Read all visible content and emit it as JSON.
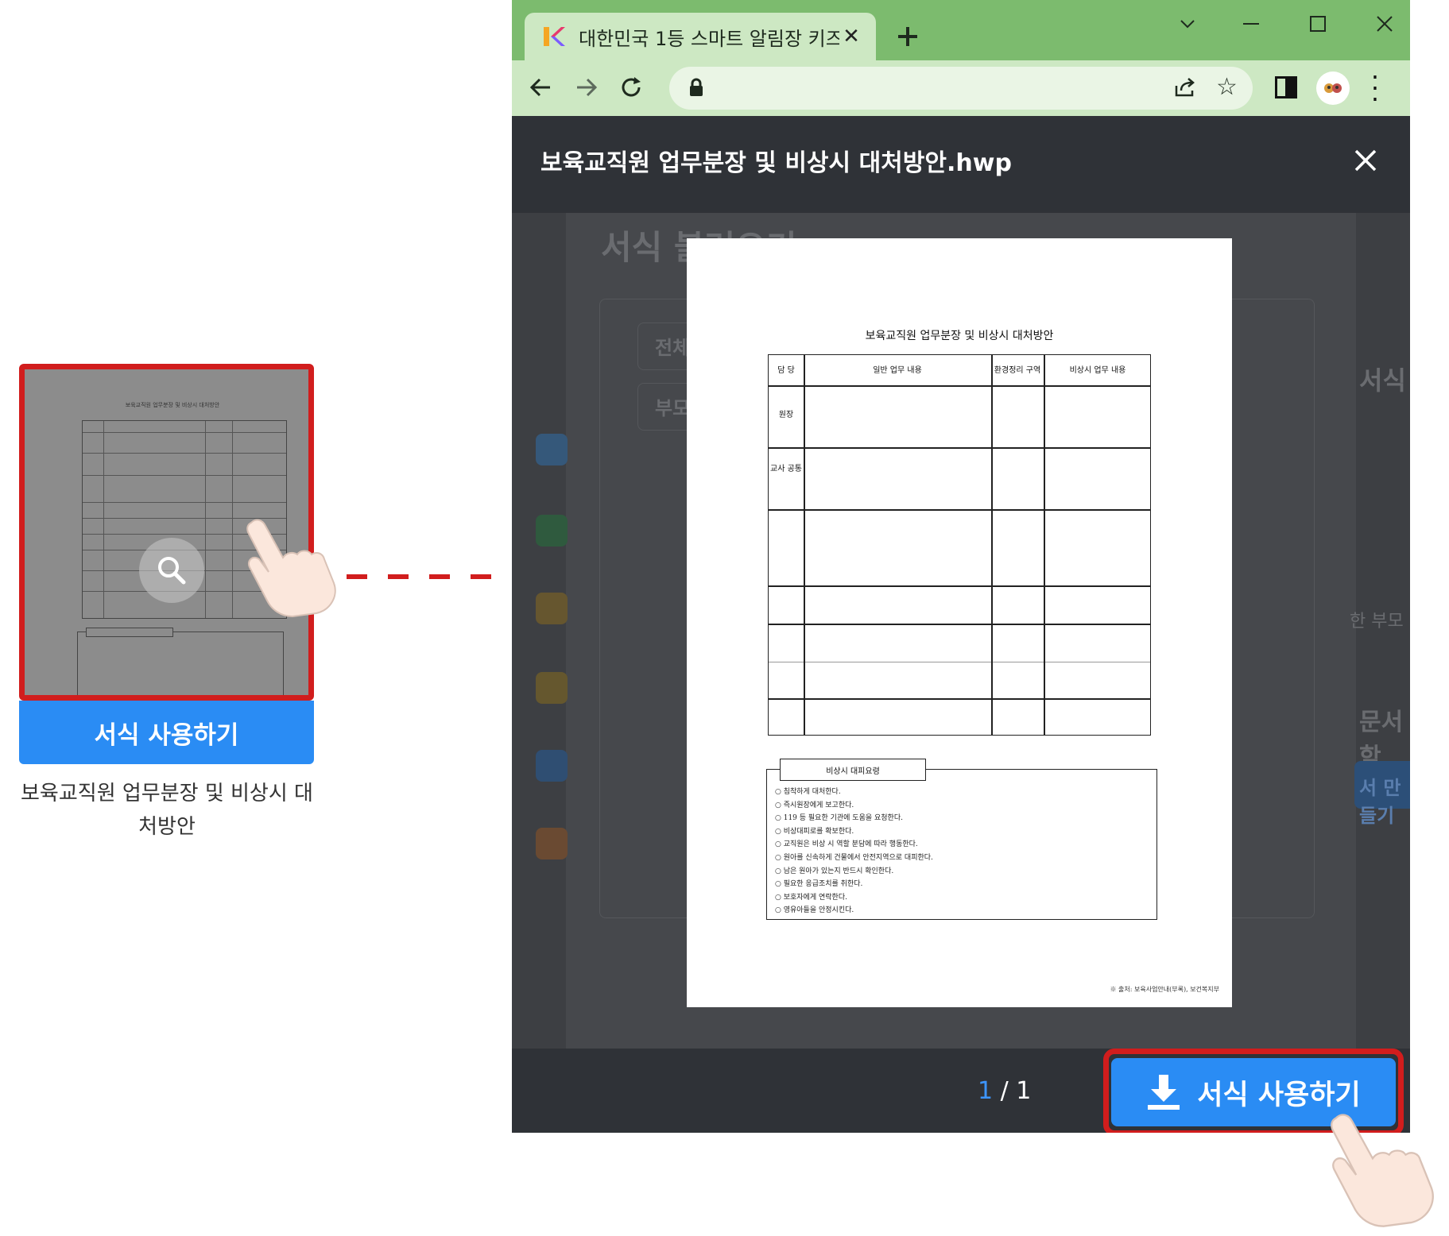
{
  "card": {
    "thumbnail": {
      "title": "보육교직원 업무분장 및 비상시 대처방안"
    },
    "button_label": "서식 사용하기",
    "caption": "보육교직원 업무분장 및 비상시 대처방안"
  },
  "browser": {
    "tab_title": "대한민국 1등 스마트 알림장 키즈",
    "new_tab_icon": "plus-icon"
  },
  "modal": {
    "title": "보육교직원 업무분장 및 비상시 대처방안.hwp",
    "page_current": "1",
    "page_separator": " / ",
    "page_total": "1",
    "use_button_label": "서식 사용하기"
  },
  "background_page": {
    "heading": "서식 불러오기",
    "filter_all": "전체",
    "filter_parent": "부모",
    "side_label_1": "서식",
    "side_label_2": "한 부모",
    "side_label_3": "문서함",
    "side_button": "서 만들기"
  },
  "document": {
    "title": "보육교직원 업무분장 및 비상시 대처방안",
    "headers": [
      "담 당",
      "일반 업무 내용",
      "환경정리 구역",
      "비상시 업무 내용"
    ],
    "row_labels": [
      "원장",
      "교사 공통"
    ],
    "emergency_title": "비상시 대피요령",
    "emergency_items": [
      "○ 침착하게 대처한다.",
      "○ 즉시원장에게 보고한다.",
      "○ 119 등 필요한 기관에 도움을 요청한다.",
      "○ 비상대피로를 확보한다.",
      "○ 교직원은 비상 시 역할 분담에 따라 행동한다.",
      "○ 원아를 신속하게 건물에서 안전지역으로 대피한다.",
      "○ 남은 원아가 있는지 반드시 확인한다.",
      "○ 필요한 응급조치를 취한다.",
      "○ 보호자에게 연락한다.",
      "○ 영유아들을 안정시킨다."
    ],
    "source": "※ 출처: 보육사업안내(부록), 보건복지부"
  },
  "colors": {
    "highlight_red": "#d11d1d",
    "primary_blue": "#2a8cf4",
    "tab_green": "#7cbb6e"
  }
}
